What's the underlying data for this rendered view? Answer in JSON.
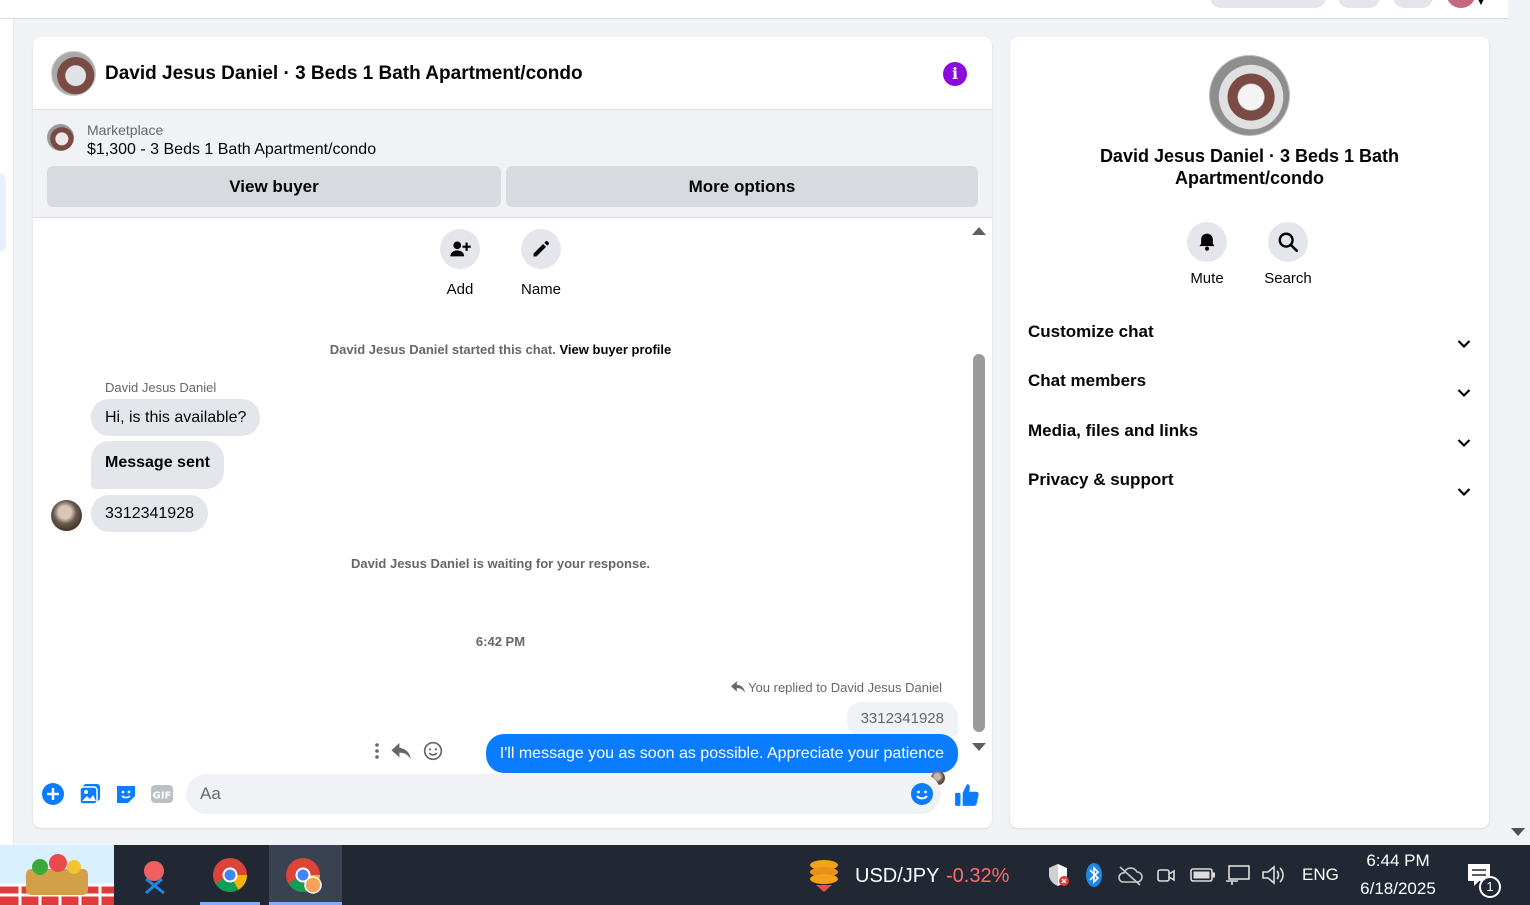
{
  "chat": {
    "title": "David Jesus Daniel · 3 Beds 1 Bath Apartment/condo",
    "marketplace_label": "Marketplace",
    "listing": "$1,300 - 3 Beds 1 Bath Apartment/condo",
    "view_buyer": "View buyer",
    "more_options": "More options",
    "tools": {
      "add": "Add",
      "name": "Name"
    },
    "started_text": "David Jesus Daniel started this chat.",
    "view_buyer_profile": "View buyer profile",
    "sender": "David Jesus Daniel",
    "messages": [
      "Hi, is this available?",
      "Message sent",
      "3312341928"
    ],
    "waiting_text": "David Jesus Daniel is waiting for your response.",
    "timestamp": "6:42 PM",
    "replied_to": "You replied to David Jesus Daniel",
    "quoted": "3312341928",
    "my_message": "I'll message you as soon as possible. Appreciate your patience",
    "composer_placeholder": "Aa"
  },
  "info": {
    "name": "David Jesus Daniel · 3 Beds 1 Bath Apartment/condo",
    "mute": "Mute",
    "search": "Search",
    "sections": [
      "Customize chat",
      "Chat members",
      "Media, files and links",
      "Privacy & support"
    ]
  },
  "taskbar": {
    "ticker": "USD/JPY",
    "change": "-0.32%",
    "lang": "ENG",
    "time": "6:44 PM",
    "date": "6/18/2025",
    "notif_count": "1"
  },
  "colors": {
    "accent": "#0a7cff",
    "info": "#8a0bdb",
    "taskbar": "#222833"
  }
}
